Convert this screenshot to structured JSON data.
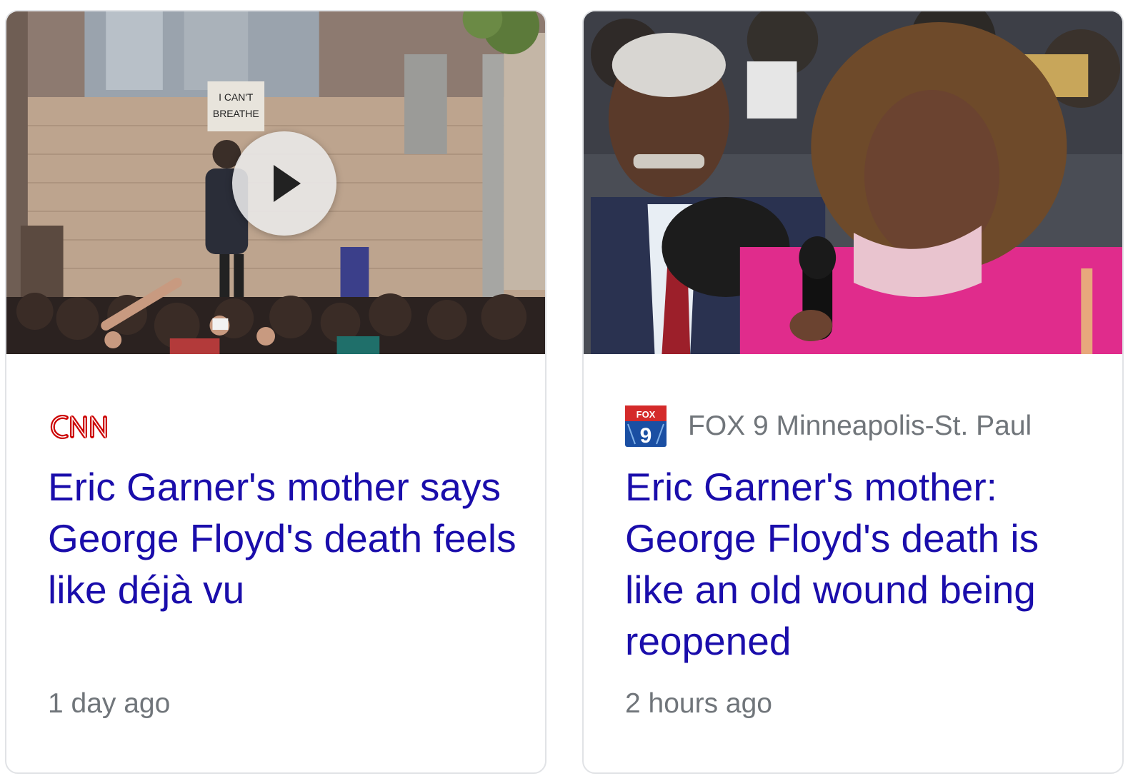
{
  "cards": [
    {
      "source": {
        "logo_text": "CNN",
        "name": ""
      },
      "headline": "Eric Garner's mother says George Floyd's death feels like déjà vu",
      "time": "1 day ago",
      "has_video": true,
      "thumbnail_sign_text": "I CAN'T BREATHE"
    },
    {
      "source": {
        "logo_text": "FOX 9",
        "name": "FOX 9 Minneapolis-St. Paul"
      },
      "headline": "Eric Garner's mother: George Floyd's death is like an old wound being reopened",
      "time": "2 hours ago",
      "has_video": false
    }
  ],
  "colors": {
    "headline": "#1a0dab",
    "meta_text": "#70757a",
    "card_border": "#e1e3e6",
    "cnn_red": "#cc0000",
    "fox_blue": "#1a4fa3"
  }
}
